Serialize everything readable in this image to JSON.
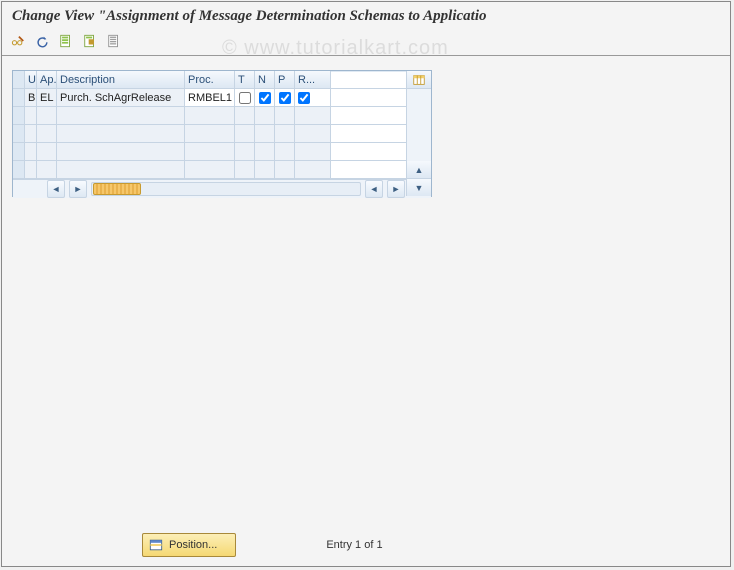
{
  "title": "Change View \"Assignment of Message Determination Schemas to Applicatio",
  "watermark": "© www.tutorialkart.com",
  "toolbar": {
    "icons": [
      "glasses-pencil",
      "undo",
      "form-green",
      "form-save",
      "form-list"
    ]
  },
  "grid": {
    "columns": {
      "u": "U",
      "ap": "Ap.",
      "description": "Description",
      "proc": "Proc.",
      "t": "T",
      "n": "N",
      "p": "P",
      "r": "R..."
    },
    "rows": [
      {
        "u": "B",
        "ap": "EL",
        "description": "Purch. SchAgrRelease",
        "proc": "RMBEL1",
        "t": false,
        "n": true,
        "p": true,
        "r": true
      }
    ]
  },
  "bottom": {
    "position_btn": "Position...",
    "status": "Entry 1 of 1"
  }
}
